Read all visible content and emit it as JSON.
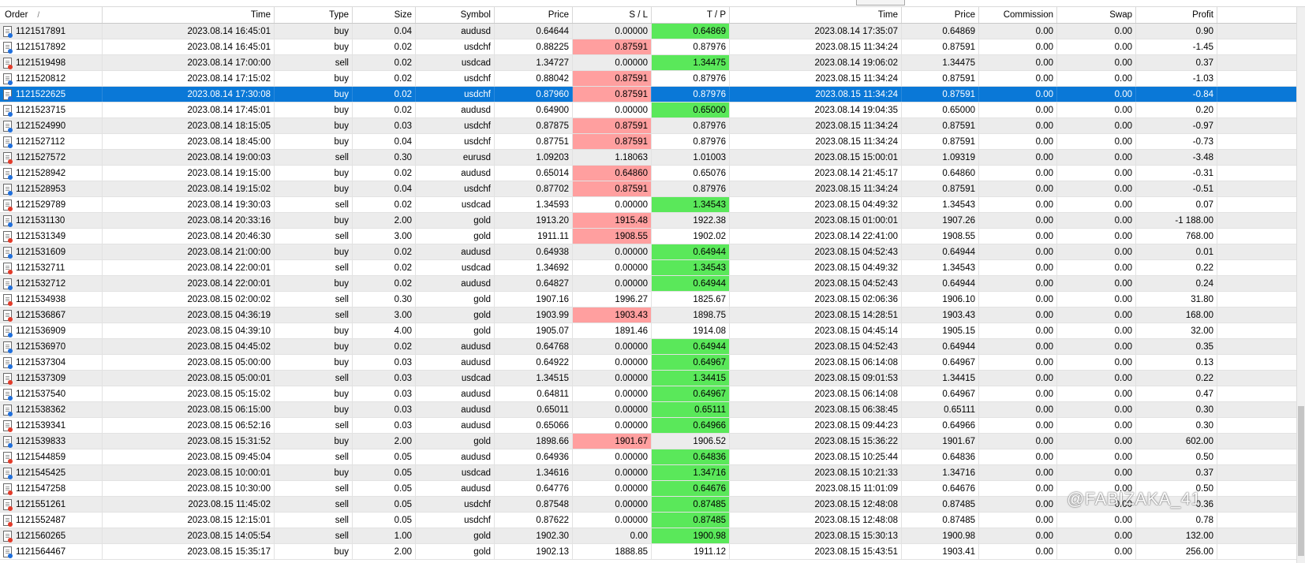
{
  "columns": [
    {
      "key": "order",
      "label": "Order",
      "sort": "/"
    },
    {
      "key": "open_time",
      "label": "Time"
    },
    {
      "key": "type",
      "label": "Type"
    },
    {
      "key": "size",
      "label": "Size"
    },
    {
      "key": "symbol",
      "label": "Symbol"
    },
    {
      "key": "open_price",
      "label": "Price"
    },
    {
      "key": "sl",
      "label": "S / L"
    },
    {
      "key": "tp",
      "label": "T / P"
    },
    {
      "key": "close_time",
      "label": "Time"
    },
    {
      "key": "close_price",
      "label": "Price"
    },
    {
      "key": "commission",
      "label": "Commission"
    },
    {
      "key": "swap",
      "label": "Swap"
    },
    {
      "key": "profit",
      "label": "Profit"
    }
  ],
  "colors": {
    "sl_hit": "#ff9f9f",
    "tp_hit": "#5ae85a",
    "selected": "#0a78d7"
  },
  "selected_order": "1121522625",
  "rows": [
    {
      "order": "1121517891",
      "open_time": "2023.08.14 16:45:01",
      "type": "buy",
      "size": "0.04",
      "symbol": "audusd",
      "open_price": "0.64644",
      "sl": "0.00000",
      "tp": "0.64869",
      "close_time": "2023.08.14 17:35:07",
      "close_price": "0.64869",
      "commission": "0.00",
      "swap": "0.00",
      "profit": "0.90",
      "hit": "tp"
    },
    {
      "order": "1121517892",
      "open_time": "2023.08.14 16:45:01",
      "type": "buy",
      "size": "0.02",
      "symbol": "usdchf",
      "open_price": "0.88225",
      "sl": "0.87591",
      "tp": "0.87976",
      "close_time": "2023.08.15 11:34:24",
      "close_price": "0.87591",
      "commission": "0.00",
      "swap": "0.00",
      "profit": "-1.45",
      "hit": "sl"
    },
    {
      "order": "1121519498",
      "open_time": "2023.08.14 17:00:00",
      "type": "sell",
      "size": "0.02",
      "symbol": "usdcad",
      "open_price": "1.34727",
      "sl": "0.00000",
      "tp": "1.34475",
      "close_time": "2023.08.14 19:06:02",
      "close_price": "1.34475",
      "commission": "0.00",
      "swap": "0.00",
      "profit": "0.37",
      "hit": "tp"
    },
    {
      "order": "1121520812",
      "open_time": "2023.08.14 17:15:02",
      "type": "buy",
      "size": "0.02",
      "symbol": "usdchf",
      "open_price": "0.88042",
      "sl": "0.87591",
      "tp": "0.87976",
      "close_time": "2023.08.15 11:34:24",
      "close_price": "0.87591",
      "commission": "0.00",
      "swap": "0.00",
      "profit": "-1.03",
      "hit": "sl"
    },
    {
      "order": "1121522625",
      "open_time": "2023.08.14 17:30:08",
      "type": "buy",
      "size": "0.02",
      "symbol": "usdchf",
      "open_price": "0.87960",
      "sl": "0.87591",
      "tp": "0.87976",
      "close_time": "2023.08.15 11:34:24",
      "close_price": "0.87591",
      "commission": "0.00",
      "swap": "0.00",
      "profit": "-0.84",
      "hit": "sl"
    },
    {
      "order": "1121523715",
      "open_time": "2023.08.14 17:45:01",
      "type": "buy",
      "size": "0.02",
      "symbol": "audusd",
      "open_price": "0.64900",
      "sl": "0.00000",
      "tp": "0.65000",
      "close_time": "2023.08.14 19:04:35",
      "close_price": "0.65000",
      "commission": "0.00",
      "swap": "0.00",
      "profit": "0.20",
      "hit": "tp"
    },
    {
      "order": "1121524990",
      "open_time": "2023.08.14 18:15:05",
      "type": "buy",
      "size": "0.03",
      "symbol": "usdchf",
      "open_price": "0.87875",
      "sl": "0.87591",
      "tp": "0.87976",
      "close_time": "2023.08.15 11:34:24",
      "close_price": "0.87591",
      "commission": "0.00",
      "swap": "0.00",
      "profit": "-0.97",
      "hit": "sl"
    },
    {
      "order": "1121527112",
      "open_time": "2023.08.14 18:45:00",
      "type": "buy",
      "size": "0.04",
      "symbol": "usdchf",
      "open_price": "0.87751",
      "sl": "0.87591",
      "tp": "0.87976",
      "close_time": "2023.08.15 11:34:24",
      "close_price": "0.87591",
      "commission": "0.00",
      "swap": "0.00",
      "profit": "-0.73",
      "hit": "sl"
    },
    {
      "order": "1121527572",
      "open_time": "2023.08.14 19:00:03",
      "type": "sell",
      "size": "0.30",
      "symbol": "eurusd",
      "open_price": "1.09203",
      "sl": "1.18063",
      "tp": "1.01003",
      "close_time": "2023.08.15 15:00:01",
      "close_price": "1.09319",
      "commission": "0.00",
      "swap": "0.00",
      "profit": "-3.48",
      "hit": ""
    },
    {
      "order": "1121528942",
      "open_time": "2023.08.14 19:15:00",
      "type": "buy",
      "size": "0.02",
      "symbol": "audusd",
      "open_price": "0.65014",
      "sl": "0.64860",
      "tp": "0.65076",
      "close_time": "2023.08.14 21:45:17",
      "close_price": "0.64860",
      "commission": "0.00",
      "swap": "0.00",
      "profit": "-0.31",
      "hit": "sl"
    },
    {
      "order": "1121528953",
      "open_time": "2023.08.14 19:15:02",
      "type": "buy",
      "size": "0.04",
      "symbol": "usdchf",
      "open_price": "0.87702",
      "sl": "0.87591",
      "tp": "0.87976",
      "close_time": "2023.08.15 11:34:24",
      "close_price": "0.87591",
      "commission": "0.00",
      "swap": "0.00",
      "profit": "-0.51",
      "hit": "sl"
    },
    {
      "order": "1121529789",
      "open_time": "2023.08.14 19:30:03",
      "type": "sell",
      "size": "0.02",
      "symbol": "usdcad",
      "open_price": "1.34593",
      "sl": "0.00000",
      "tp": "1.34543",
      "close_time": "2023.08.15 04:49:32",
      "close_price": "1.34543",
      "commission": "0.00",
      "swap": "0.00",
      "profit": "0.07",
      "hit": "tp"
    },
    {
      "order": "1121531130",
      "open_time": "2023.08.14 20:33:16",
      "type": "buy",
      "size": "2.00",
      "symbol": "gold",
      "open_price": "1913.20",
      "sl": "1915.48",
      "tp": "1922.38",
      "close_time": "2023.08.15 01:00:01",
      "close_price": "1907.26",
      "commission": "0.00",
      "swap": "0.00",
      "profit": "-1 188.00",
      "hit": "sl"
    },
    {
      "order": "1121531349",
      "open_time": "2023.08.14 20:46:30",
      "type": "sell",
      "size": "3.00",
      "symbol": "gold",
      "open_price": "1911.11",
      "sl": "1908.55",
      "tp": "1902.02",
      "close_time": "2023.08.14 22:41:00",
      "close_price": "1908.55",
      "commission": "0.00",
      "swap": "0.00",
      "profit": "768.00",
      "hit": "sl"
    },
    {
      "order": "1121531609",
      "open_time": "2023.08.14 21:00:00",
      "type": "buy",
      "size": "0.02",
      "symbol": "audusd",
      "open_price": "0.64938",
      "sl": "0.00000",
      "tp": "0.64944",
      "close_time": "2023.08.15 04:52:43",
      "close_price": "0.64944",
      "commission": "0.00",
      "swap": "0.00",
      "profit": "0.01",
      "hit": "tp"
    },
    {
      "order": "1121532711",
      "open_time": "2023.08.14 22:00:01",
      "type": "sell",
      "size": "0.02",
      "symbol": "usdcad",
      "open_price": "1.34692",
      "sl": "0.00000",
      "tp": "1.34543",
      "close_time": "2023.08.15 04:49:32",
      "close_price": "1.34543",
      "commission": "0.00",
      "swap": "0.00",
      "profit": "0.22",
      "hit": "tp"
    },
    {
      "order": "1121532712",
      "open_time": "2023.08.14 22:00:01",
      "type": "buy",
      "size": "0.02",
      "symbol": "audusd",
      "open_price": "0.64827",
      "sl": "0.00000",
      "tp": "0.64944",
      "close_time": "2023.08.15 04:52:43",
      "close_price": "0.64944",
      "commission": "0.00",
      "swap": "0.00",
      "profit": "0.24",
      "hit": "tp"
    },
    {
      "order": "1121534938",
      "open_time": "2023.08.15 02:00:02",
      "type": "sell",
      "size": "0.30",
      "symbol": "gold",
      "open_price": "1907.16",
      "sl": "1996.27",
      "tp": "1825.67",
      "close_time": "2023.08.15 02:06:36",
      "close_price": "1906.10",
      "commission": "0.00",
      "swap": "0.00",
      "profit": "31.80",
      "hit": ""
    },
    {
      "order": "1121536867",
      "open_time": "2023.08.15 04:36:19",
      "type": "sell",
      "size": "3.00",
      "symbol": "gold",
      "open_price": "1903.99",
      "sl": "1903.43",
      "tp": "1898.75",
      "close_time": "2023.08.15 14:28:51",
      "close_price": "1903.43",
      "commission": "0.00",
      "swap": "0.00",
      "profit": "168.00",
      "hit": "sl"
    },
    {
      "order": "1121536909",
      "open_time": "2023.08.15 04:39:10",
      "type": "buy",
      "size": "4.00",
      "symbol": "gold",
      "open_price": "1905.07",
      "sl": "1891.46",
      "tp": "1914.08",
      "close_time": "2023.08.15 04:45:14",
      "close_price": "1905.15",
      "commission": "0.00",
      "swap": "0.00",
      "profit": "32.00",
      "hit": ""
    },
    {
      "order": "1121536970",
      "open_time": "2023.08.15 04:45:02",
      "type": "buy",
      "size": "0.02",
      "symbol": "audusd",
      "open_price": "0.64768",
      "sl": "0.00000",
      "tp": "0.64944",
      "close_time": "2023.08.15 04:52:43",
      "close_price": "0.64944",
      "commission": "0.00",
      "swap": "0.00",
      "profit": "0.35",
      "hit": "tp"
    },
    {
      "order": "1121537304",
      "open_time": "2023.08.15 05:00:00",
      "type": "buy",
      "size": "0.03",
      "symbol": "audusd",
      "open_price": "0.64922",
      "sl": "0.00000",
      "tp": "0.64967",
      "close_time": "2023.08.15 06:14:08",
      "close_price": "0.64967",
      "commission": "0.00",
      "swap": "0.00",
      "profit": "0.13",
      "hit": "tp"
    },
    {
      "order": "1121537309",
      "open_time": "2023.08.15 05:00:01",
      "type": "sell",
      "size": "0.03",
      "symbol": "usdcad",
      "open_price": "1.34515",
      "sl": "0.00000",
      "tp": "1.34415",
      "close_time": "2023.08.15 09:01:53",
      "close_price": "1.34415",
      "commission": "0.00",
      "swap": "0.00",
      "profit": "0.22",
      "hit": "tp"
    },
    {
      "order": "1121537540",
      "open_time": "2023.08.15 05:15:02",
      "type": "buy",
      "size": "0.03",
      "symbol": "audusd",
      "open_price": "0.64811",
      "sl": "0.00000",
      "tp": "0.64967",
      "close_time": "2023.08.15 06:14:08",
      "close_price": "0.64967",
      "commission": "0.00",
      "swap": "0.00",
      "profit": "0.47",
      "hit": "tp"
    },
    {
      "order": "1121538362",
      "open_time": "2023.08.15 06:15:00",
      "type": "buy",
      "size": "0.03",
      "symbol": "audusd",
      "open_price": "0.65011",
      "sl": "0.00000",
      "tp": "0.65111",
      "close_time": "2023.08.15 06:38:45",
      "close_price": "0.65111",
      "commission": "0.00",
      "swap": "0.00",
      "profit": "0.30",
      "hit": "tp"
    },
    {
      "order": "1121539341",
      "open_time": "2023.08.15 06:52:16",
      "type": "sell",
      "size": "0.03",
      "symbol": "audusd",
      "open_price": "0.65066",
      "sl": "0.00000",
      "tp": "0.64966",
      "close_time": "2023.08.15 09:44:23",
      "close_price": "0.64966",
      "commission": "0.00",
      "swap": "0.00",
      "profit": "0.30",
      "hit": "tp"
    },
    {
      "order": "1121539833",
      "open_time": "2023.08.15 15:31:52",
      "type": "buy",
      "size": "2.00",
      "symbol": "gold",
      "open_price": "1898.66",
      "sl": "1901.67",
      "tp": "1906.52",
      "close_time": "2023.08.15 15:36:22",
      "close_price": "1901.67",
      "commission": "0.00",
      "swap": "0.00",
      "profit": "602.00",
      "hit": "sl"
    },
    {
      "order": "1121544859",
      "open_time": "2023.08.15 09:45:04",
      "type": "sell",
      "size": "0.05",
      "symbol": "audusd",
      "open_price": "0.64936",
      "sl": "0.00000",
      "tp": "0.64836",
      "close_time": "2023.08.15 10:25:44",
      "close_price": "0.64836",
      "commission": "0.00",
      "swap": "0.00",
      "profit": "0.50",
      "hit": "tp"
    },
    {
      "order": "1121545425",
      "open_time": "2023.08.15 10:00:01",
      "type": "buy",
      "size": "0.05",
      "symbol": "usdcad",
      "open_price": "1.34616",
      "sl": "0.00000",
      "tp": "1.34716",
      "close_time": "2023.08.15 10:21:33",
      "close_price": "1.34716",
      "commission": "0.00",
      "swap": "0.00",
      "profit": "0.37",
      "hit": "tp"
    },
    {
      "order": "1121547258",
      "open_time": "2023.08.15 10:30:00",
      "type": "sell",
      "size": "0.05",
      "symbol": "audusd",
      "open_price": "0.64776",
      "sl": "0.00000",
      "tp": "0.64676",
      "close_time": "2023.08.15 11:01:09",
      "close_price": "0.64676",
      "commission": "0.00",
      "swap": "0.00",
      "profit": "0.50",
      "hit": "tp"
    },
    {
      "order": "1121551261",
      "open_time": "2023.08.15 11:45:02",
      "type": "sell",
      "size": "0.05",
      "symbol": "usdchf",
      "open_price": "0.87548",
      "sl": "0.00000",
      "tp": "0.87485",
      "close_time": "2023.08.15 12:48:08",
      "close_price": "0.87485",
      "commission": "0.00",
      "swap": "0.00",
      "profit": "0.36",
      "hit": "tp"
    },
    {
      "order": "1121552487",
      "open_time": "2023.08.15 12:15:01",
      "type": "sell",
      "size": "0.05",
      "symbol": "usdchf",
      "open_price": "0.87622",
      "sl": "0.00000",
      "tp": "0.87485",
      "close_time": "2023.08.15 12:48:08",
      "close_price": "0.87485",
      "commission": "0.00",
      "swap": "0.00",
      "profit": "0.78",
      "hit": "tp"
    },
    {
      "order": "1121560265",
      "open_time": "2023.08.15 14:05:54",
      "type": "sell",
      "size": "1.00",
      "symbol": "gold",
      "open_price": "1902.30",
      "sl": "0.00",
      "tp": "1900.98",
      "close_time": "2023.08.15 15:30:13",
      "close_price": "1900.98",
      "commission": "0.00",
      "swap": "0.00",
      "profit": "132.00",
      "hit": "tp"
    },
    {
      "order": "1121564467",
      "open_time": "2023.08.15 15:35:17",
      "type": "buy",
      "size": "2.00",
      "symbol": "gold",
      "open_price": "1902.13",
      "sl": "1888.85",
      "tp": "1911.12",
      "close_time": "2023.08.15 15:43:51",
      "close_price": "1903.41",
      "commission": "0.00",
      "swap": "0.00",
      "profit": "256.00",
      "hit": ""
    }
  ],
  "watermark": "@FABIZAKA_41"
}
